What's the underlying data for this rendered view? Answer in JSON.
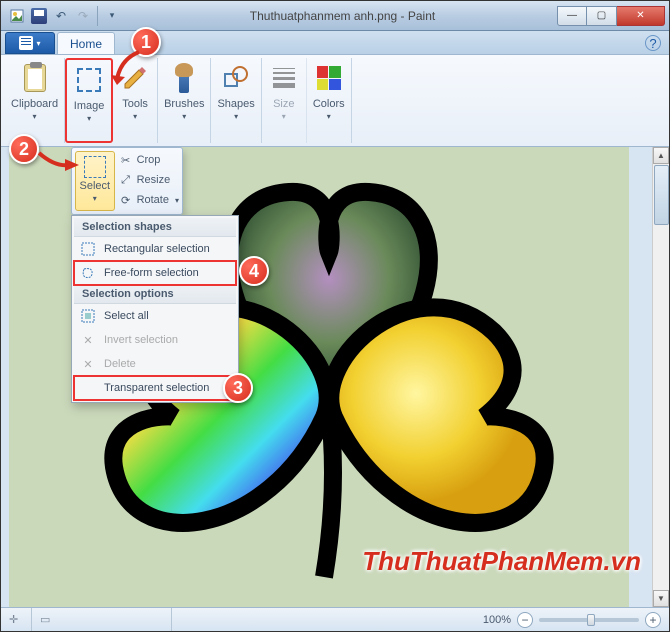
{
  "titlebar": {
    "title": "Thuthuatphanmem anh.png - Paint"
  },
  "tabs": {
    "home": "Home"
  },
  "ribbon": {
    "clipboard": "Clipboard",
    "image": "Image",
    "tools": "Tools",
    "brushes": "Brushes",
    "shapes": "Shapes",
    "size": "Size",
    "colors": "Colors"
  },
  "image_panel": {
    "select": "Select",
    "crop": "Crop",
    "resize": "Resize",
    "rotate": "Rotate"
  },
  "dropdown": {
    "section_shapes": "Selection shapes",
    "rect": "Rectangular selection",
    "free": "Free-form selection",
    "section_options": "Selection options",
    "select_all": "Select all",
    "invert": "Invert selection",
    "delete": "Delete",
    "transparent": "Transparent selection"
  },
  "status": {
    "zoom_pct": "100%"
  },
  "callouts": {
    "c1": "1",
    "c2": "2",
    "c3": "3",
    "c4": "4"
  },
  "watermark": "ThuThuatPhanMem.vn"
}
